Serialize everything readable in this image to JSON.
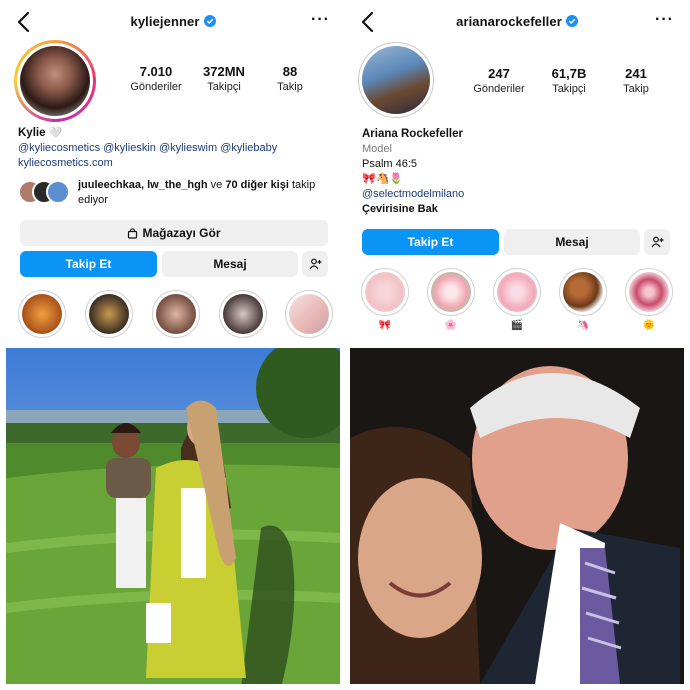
{
  "profiles": [
    {
      "username": "kyliejenner",
      "stats": [
        {
          "value": "7.010",
          "label": "Gönderiler"
        },
        {
          "value": "372MN",
          "label": "Takipçi"
        },
        {
          "value": "88",
          "label": "Takip"
        }
      ],
      "display_name": "Kylie",
      "display_name_emoji": "🤍",
      "bio_links": [
        "@kyliecosmetics",
        "@kylieskin",
        "@kylieswim",
        "@kyliebaby"
      ],
      "website": "kyliecosmetics.com",
      "followed_by": {
        "names": "juuleechkaa, lw_the_hgh",
        "middle": " ve ",
        "count_text": "70 diğer kişi",
        "suffix": " takip ediyor"
      },
      "shop_button": "Mağazayı Gör",
      "follow_button": "Takip Et",
      "message_button": "Mesaj"
    },
    {
      "username": "arianarockefeller",
      "stats": [
        {
          "value": "247",
          "label": "Gönderiler"
        },
        {
          "value": "61,7B",
          "label": "Takipçi"
        },
        {
          "value": "241",
          "label": "Takip"
        }
      ],
      "display_name": "Ariana Rockefeller",
      "category": "Model",
      "bio_line": "Psalm 46:5",
      "bio_emojis": "🎀🐴🌷",
      "bio_links": [
        "@selectmodelmilano"
      ],
      "translate": "Çevirisine Bak",
      "follow_button": "Takip Et",
      "message_button": "Mesaj",
      "highlights": [
        "🎀",
        "🌸",
        "🎬",
        "🦄",
        "🌞"
      ]
    }
  ],
  "colors": {
    "accent": "#0a95f6",
    "verified": "#1f8ff0",
    "link": "#1d3b7a",
    "button_gray": "#efefef"
  }
}
